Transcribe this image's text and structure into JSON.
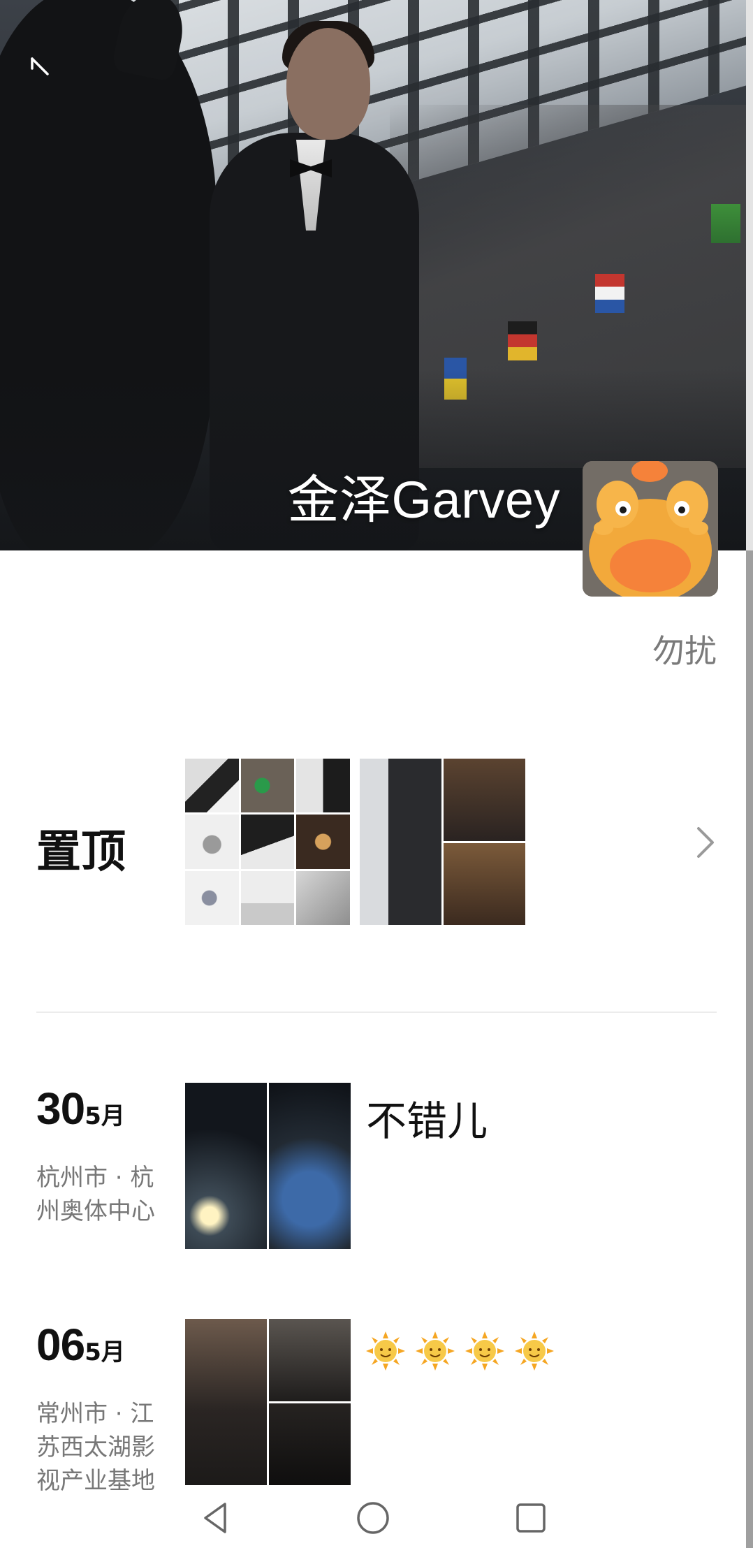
{
  "profile": {
    "name": "金泽Garvey",
    "signature": "勿扰",
    "back_icon": "back-arrow-icon",
    "avatar_desc": "avatar"
  },
  "pinned": {
    "label": "置顶",
    "chevron_icon": "chevron-right-icon"
  },
  "posts": [
    {
      "day": "30",
      "month": "5月",
      "location": "杭州市 · 杭州奥体中心",
      "text": "不错儿"
    },
    {
      "day": "06",
      "month": "5月",
      "location": "常州市 · 江苏西太湖影视产业基地",
      "emoji": [
        "🌞",
        "🌞",
        "🌞",
        "🌞"
      ]
    }
  ],
  "navbar": {
    "back": "nav-back-icon",
    "home": "nav-home-icon",
    "recents": "nav-recents-icon"
  },
  "colors": {
    "accent_text": "#111111",
    "secondary_text": "#777777",
    "cover_dark": "#1d2024"
  }
}
